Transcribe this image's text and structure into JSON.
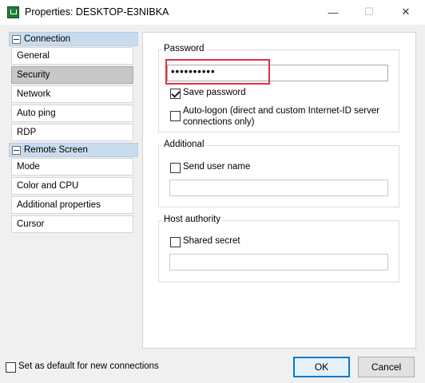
{
  "window": {
    "title": "Properties: DESKTOP-E3NIBKA",
    "minimize_glyph": "—",
    "maximize_glyph": "☐",
    "close_glyph": "✕"
  },
  "sidebar": {
    "groups": [
      {
        "label": "Connection",
        "items": [
          {
            "label": "General"
          },
          {
            "label": "Security"
          },
          {
            "label": "Network"
          },
          {
            "label": "Auto ping"
          },
          {
            "label": "RDP"
          }
        ]
      },
      {
        "label": "Remote Screen",
        "items": [
          {
            "label": "Mode"
          },
          {
            "label": "Color and CPU"
          },
          {
            "label": "Additional properties"
          },
          {
            "label": "Cursor"
          }
        ]
      }
    ],
    "selected_item": "Security"
  },
  "password_group": {
    "title": "Password",
    "value_masked": "••••••••••",
    "save_password_label": "Save password",
    "save_password_checked": true,
    "auto_logon_label_line1": "Auto-logon (direct and custom Internet-ID server",
    "auto_logon_label_line2": "connections only)",
    "auto_logon_checked": false
  },
  "additional_group": {
    "title": "Additional",
    "send_user_name_label": "Send user name",
    "send_user_name_checked": false,
    "user_name_value": ""
  },
  "host_authority_group": {
    "title": "Host authority",
    "shared_secret_label": "Shared secret",
    "shared_secret_checked": false,
    "shared_secret_value": ""
  },
  "footer": {
    "default_label": "Set as default for new connections",
    "default_checked": false,
    "ok_label": "OK",
    "cancel_label": "Cancel"
  },
  "colors": {
    "highlight_border": "#e5323b",
    "selected_item_bg": "#c7c7c7",
    "group_header_bg": "#c9dcee",
    "ok_button_border": "#0078d7"
  }
}
